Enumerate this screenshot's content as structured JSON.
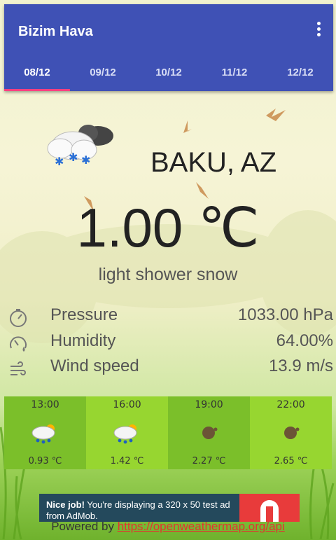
{
  "app": {
    "title": "Bizim Hava"
  },
  "tabs": [
    {
      "label": "08/12"
    },
    {
      "label": "09/12"
    },
    {
      "label": "10/12"
    },
    {
      "label": "11/12"
    },
    {
      "label": "12/12"
    }
  ],
  "weather": {
    "city": "BAKU, AZ",
    "temperature": "1.00 ℃",
    "description": "light shower snow",
    "icon": "snow-cloud-icon"
  },
  "stats": [
    {
      "label": "Pressure",
      "value": "1033.00 hPa",
      "icon": "pressure-gauge-icon"
    },
    {
      "label": "Humidity",
      "value": "64.00%",
      "icon": "humidity-gauge-icon"
    },
    {
      "label": "Wind speed",
      "value": "13.9 m/s",
      "icon": "wind-icon"
    }
  ],
  "forecast": [
    {
      "time": "13:00",
      "temp": "0.93 ℃",
      "icon": "rain-sun-cloud-icon"
    },
    {
      "time": "16:00",
      "temp": "1.42 ℃",
      "icon": "rain-sun-cloud-icon"
    },
    {
      "time": "19:00",
      "temp": "2.27 ℃",
      "icon": "moon-icon"
    },
    {
      "time": "22:00",
      "temp": "2.65 ℃",
      "icon": "moon-icon"
    }
  ],
  "ad": {
    "title": "Nice job!",
    "text": "You're displaying a 320 x 50 test ad from AdMob."
  },
  "footer": {
    "prefix": "Powered by ",
    "link": "https://openweathermap.org/api"
  },
  "colors": {
    "appbar": "#3f51b5",
    "tab_indicator": "#ff4081",
    "link": "#e3342f"
  }
}
